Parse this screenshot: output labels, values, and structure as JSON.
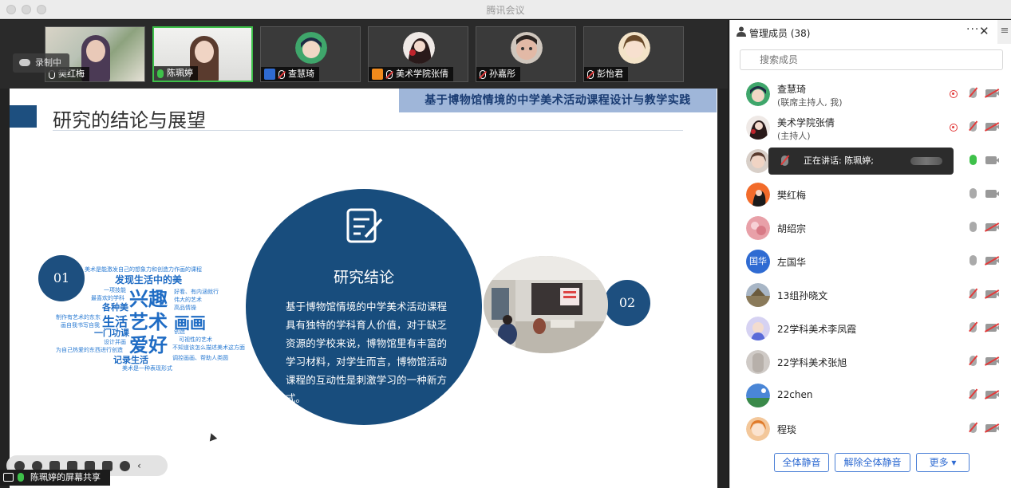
{
  "window": {
    "title": "腾讯会议"
  },
  "recording": {
    "label": "录制中"
  },
  "video_strip": {
    "tiles": [
      {
        "name": "樊红梅"
      },
      {
        "name": "陈珮婷"
      },
      {
        "name": "查慧琦"
      },
      {
        "name": "美术学院张倩"
      },
      {
        "name": "孙嘉彤"
      },
      {
        "name": "彭怡君"
      }
    ]
  },
  "slide": {
    "banner": "基于博物馆情境的中学美术活动课程设计与教学实践",
    "heading": "研究的结论与展望",
    "num1": "01",
    "num2": "02",
    "circle_title": "研究结论",
    "circle_body": "基于博物馆情境的中学美术活动课程具有独特的学科育人价值，对于缺乏资源的学校来说，博物馆里有丰富的学习材料，对学生而言，博物馆活动课程的互动性是刺激学习的一种新方式。",
    "wordcloud": {
      "w1": "兴趣",
      "w2": "艺术",
      "w3": "画画",
      "w4": "爱好",
      "w5": "生活",
      "w6": "发现生活中的美",
      "w7": "一门功课",
      "w8": "各种美",
      "w9": "记录生活",
      "s1": "美术是能激发自己的想象力和创造力作画的课程",
      "s2": "一项技能",
      "s3": "最喜欢的学科",
      "s4": "好看、有内涵就行",
      "s5": "伟大的艺术",
      "s6": "高品情操",
      "s7": "制作有艺术的东东",
      "s8": "画自我书写自我",
      "s9": "创造",
      "s10": "设计并画",
      "s11": "可视性的艺术",
      "s12": "为自己热爱的东西进行创造",
      "s13": "不知道该怎么描述美术这方面",
      "s14": "调控画画、帮助人类圆",
      "s15": "美术是一种表现形式"
    }
  },
  "share": {
    "label": "陈珮婷的屏幕共享"
  },
  "panel": {
    "title": "管理成员 (38)",
    "search_placeholder": "搜索成员",
    "speaking_text": "正在讲话: 陈珮婷;",
    "members": [
      {
        "name": "查慧琦",
        "role": "(联席主持人, 我)"
      },
      {
        "name": "美术学院张倩",
        "role": "(主持人)"
      },
      {
        "name": ""
      },
      {
        "name": "樊红梅"
      },
      {
        "name": "胡绍宗"
      },
      {
        "name": "左国华",
        "avatar_text": "国华"
      },
      {
        "name": "13组孙晓文"
      },
      {
        "name": "22学科美术李凤霞"
      },
      {
        "name": "22学科美术张旭"
      },
      {
        "name": "22chen"
      },
      {
        "name": "程琰"
      }
    ],
    "buttons": {
      "mute_all": "全体静音",
      "unmute_all": "解除全体静音",
      "more": "更多 ▾"
    }
  },
  "colors": {
    "accent": "#1d4f7f",
    "speaking_green": "#3ec14a",
    "muted_red": "#e23b3b",
    "button_blue": "#2f6bd2"
  }
}
